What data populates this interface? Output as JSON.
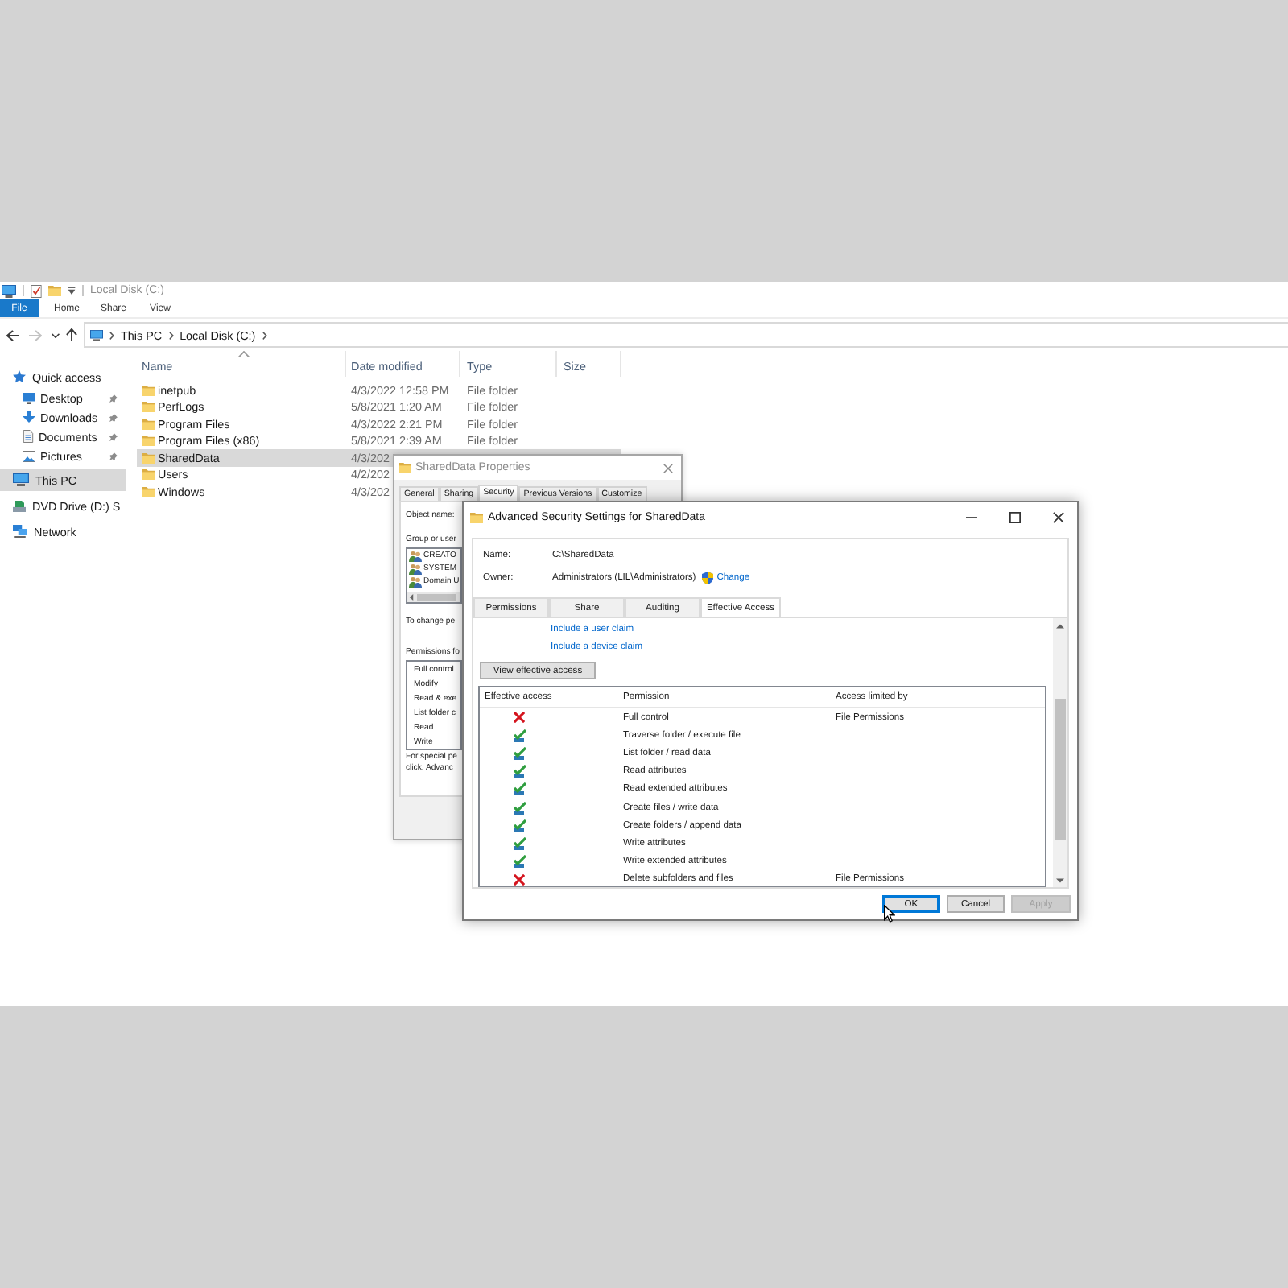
{
  "explorer": {
    "title": "Local Disk (C:)",
    "file_tab": "File",
    "ribbon_tabs": [
      "Home",
      "Share",
      "View"
    ],
    "nav_buttons": [
      {
        "kind": "back",
        "disabled": false
      },
      {
        "kind": "forward",
        "disabled": true
      },
      {
        "kind": "recent",
        "disabled": false
      },
      {
        "kind": "up",
        "disabled": false
      }
    ],
    "address": [
      "This PC",
      "Local Disk (C:)"
    ],
    "sidebar": {
      "items": [
        {
          "label": "Quick access",
          "kind": "quickaccess",
          "selected": false,
          "children": [
            {
              "label": "Desktop",
              "kind": "desktop",
              "pinned": true,
              "selected": false
            },
            {
              "label": "Downloads",
              "kind": "downloads",
              "pinned": true,
              "selected": false
            },
            {
              "label": "Documents",
              "kind": "documents",
              "pinned": true,
              "selected": false
            },
            {
              "label": "Pictures",
              "kind": "pictures",
              "pinned": true,
              "selected": false
            }
          ]
        },
        {
          "label": "This PC",
          "kind": "computer",
          "selected": true
        },
        {
          "label": "DVD Drive (D:) S",
          "kind": "drive",
          "selected": false
        },
        {
          "label": "Network",
          "kind": "network",
          "selected": false
        }
      ]
    },
    "columns": [
      "Name",
      "Date modified",
      "Type",
      "Size"
    ],
    "rows": [
      {
        "name": "inetpub",
        "date_modified": "4/3/2022 12:58 PM",
        "type": "File folder",
        "selected": false
      },
      {
        "name": "PerfLogs",
        "date_modified": "5/8/2021 1:20 AM",
        "type": "File folder",
        "selected": false
      },
      {
        "name": "Program Files",
        "date_modified": "4/3/2022 2:21 PM",
        "type": "File folder",
        "selected": false
      },
      {
        "name": "Program Files (x86)",
        "date_modified": "5/8/2021 2:39 AM",
        "type": "File folder",
        "selected": false
      },
      {
        "name": "SharedData",
        "date_modified": "4/3/202",
        "selected": true
      },
      {
        "name": "Users",
        "date_modified": "4/2/202",
        "selected": false
      },
      {
        "name": "Windows",
        "date_modified": "4/3/202",
        "selected": false
      }
    ]
  },
  "properties_dialog": {
    "title": "SharedData Properties",
    "tabs": [
      {
        "label": "General",
        "selected": false
      },
      {
        "label": "Sharing",
        "selected": false
      },
      {
        "label": "Security",
        "selected": true
      },
      {
        "label": "Previous Versions",
        "selected": false
      },
      {
        "label": "Customize",
        "selected": false
      }
    ],
    "object_name_label": "Object name:",
    "group_label": "Group or user",
    "groups": [
      "CREATO",
      "SYSTEM",
      "Domain U"
    ],
    "change_text": "To change pe",
    "permissions_label": "Permissions fo",
    "permissions": [
      "Full control",
      "Modify",
      "Read & exe",
      "List folder c",
      "Read",
      "Write"
    ],
    "special_text": [
      "For special pe",
      "click. Advanc"
    ]
  },
  "advanced_dialog": {
    "title": "Advanced Security Settings for SharedData",
    "name_label": "Name:",
    "name": "C:\\SharedData",
    "owner_label": "Owner:",
    "owner": "Administrators (LIL\\Administrators)",
    "change_link": "Change",
    "tabs": [
      {
        "label": "Permissions",
        "selected": false
      },
      {
        "label": "Share",
        "selected": false
      },
      {
        "label": "Auditing",
        "selected": false
      },
      {
        "label": "Effective Access",
        "selected": true
      }
    ],
    "links": [
      "Include a user claim",
      "Include a device claim"
    ],
    "view_button": "View effective access",
    "columns": [
      "Effective access",
      "Permission",
      "Access limited by"
    ],
    "rows": [
      {
        "kind": "denied",
        "permission": "Full control",
        "limited_by": "File Permissions"
      },
      {
        "kind": "allowed",
        "permission": "Traverse folder / execute file"
      },
      {
        "kind": "allowed",
        "permission": "List folder / read data"
      },
      {
        "kind": "allowed",
        "permission": "Read attributes"
      },
      {
        "kind": "allowed",
        "permission": "Read extended attributes"
      },
      {
        "kind": "allowed",
        "permission": "Create files / write data"
      },
      {
        "kind": "allowed",
        "permission": "Create folders / append data"
      },
      {
        "kind": "allowed",
        "permission": "Write attributes"
      },
      {
        "kind": "allowed",
        "permission": "Write extended attributes"
      },
      {
        "kind": "denied",
        "permission": "Delete subfolders and files",
        "limited_by": "File Permissions"
      }
    ],
    "buttons": [
      {
        "label": "OK",
        "default": true,
        "disabled": false
      },
      {
        "label": "Cancel",
        "default": false,
        "disabled": false
      },
      {
        "label": "Apply",
        "default": false,
        "disabled": true
      }
    ]
  }
}
